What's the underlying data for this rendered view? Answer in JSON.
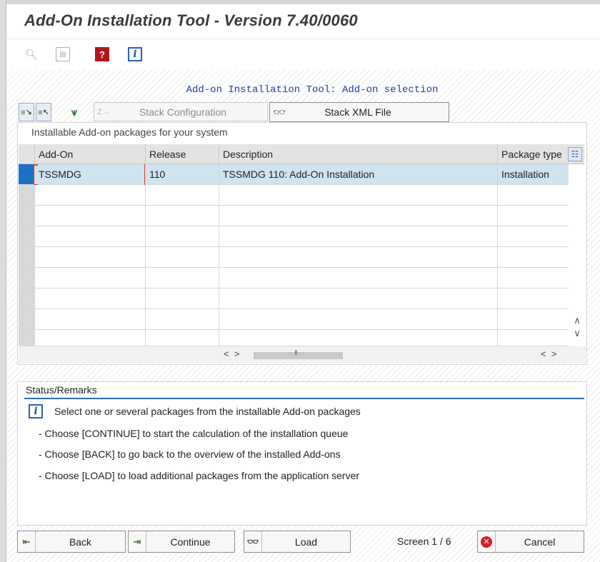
{
  "window": {
    "title": "Add-On Installation Tool - Version 7.40/0060"
  },
  "icons": {
    "toolbar": [
      "find-icon",
      "save-icon",
      "help-icon",
      "info-icon"
    ],
    "table_toolbar": [
      "select-all-icon",
      "deselect-all-icon",
      "filter-icon",
      "stack-config-icon",
      "stack-xml-icon",
      "column-selector-icon"
    ],
    "bottom": [
      "back-icon",
      "continue-icon",
      "load-icon",
      "cancel-icon"
    ]
  },
  "main": {
    "selection_title": "Add-on Installation Tool: Add-on selection",
    "table_toolbar": {
      "stack_configuration_label": "Stack Configuration",
      "stack_xml_label": "Stack XML File"
    },
    "table": {
      "caption": "Installable Add-on packages for your system",
      "columns": [
        "Add-On",
        "Release",
        "Description",
        "Package type"
      ],
      "rows": [
        [
          "TSSMDG",
          "110",
          "TSSMDG 110: Add-On Installation",
          "Installation"
        ]
      ]
    }
  },
  "status": {
    "title": "Status/Remarks",
    "lines": [
      "Select one or several packages from the installable Add-on packages",
      "- Choose [CONTINUE] to start the calculation of the installation queue",
      "- Choose [BACK] to go back to the overview of the installed Add-ons",
      "- Choose [LOAD] to load additional packages from the application server"
    ]
  },
  "footer": {
    "back_label": "Back",
    "continue_label": "Continue",
    "load_label": "Load",
    "screen_counter": "Screen 1 / 6",
    "cancel_label": "Cancel"
  },
  "colors": {
    "title_text": "#3a3a3a",
    "selection_title": "#1f3faa",
    "active_row": "#cfe3f1",
    "row_selector_active": "#1e6fc6",
    "status_rule": "#2a6cc4",
    "cancel_icon": "#d42121",
    "help_icon": "#b4151c"
  }
}
